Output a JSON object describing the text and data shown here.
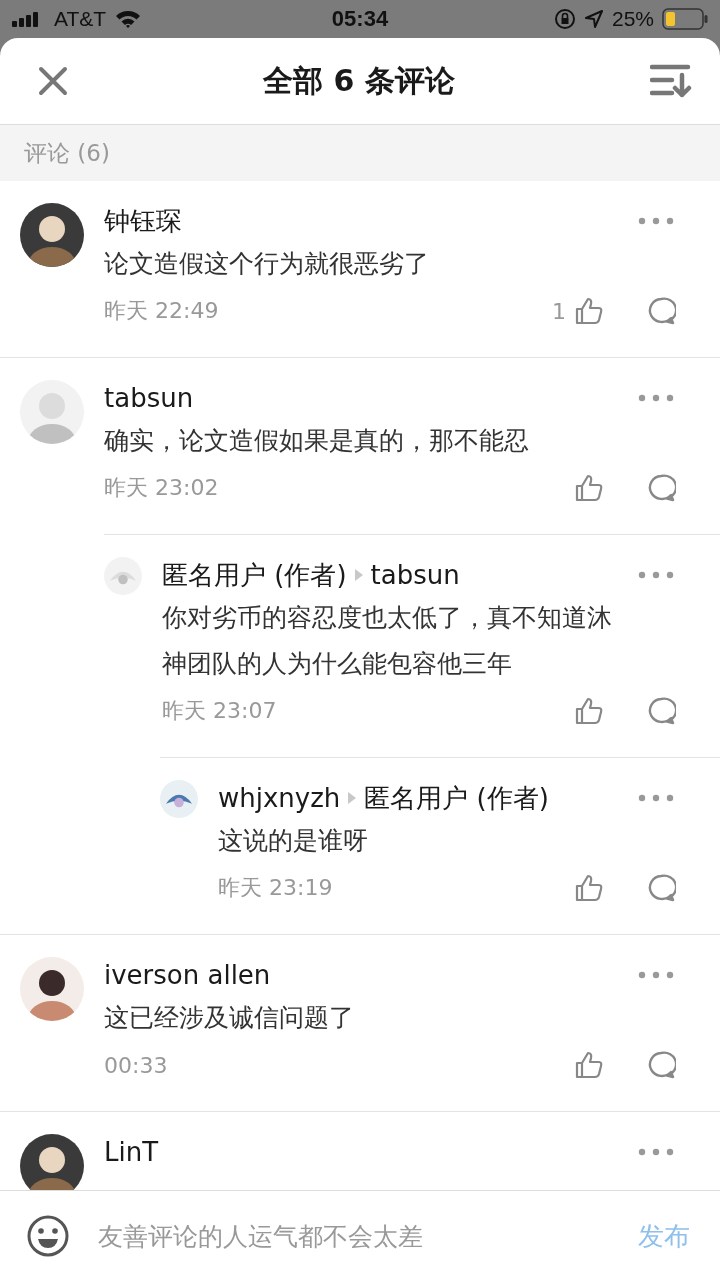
{
  "status_bar": {
    "carrier": "AT&T",
    "time": "05:34",
    "battery": "25%"
  },
  "header": {
    "title": "全部 6 条评论"
  },
  "section": {
    "label": "评论 (6)"
  },
  "comments": [
    {
      "author": "钟钰琛",
      "text": "论文造假这个行为就很恶劣了",
      "time": "昨天 22:49",
      "likes": "1"
    },
    {
      "author": "tabsun",
      "text": "确实，论文造假如果是真的，那不能忍",
      "time": "昨天 23:02",
      "replies": [
        {
          "author": "匿名用户 (作者)",
          "reply_to": "tabsun",
          "text": "你对劣币的容忍度也太低了，真不知道沐神团队的人为什么能包容他三年",
          "time": "昨天 23:07"
        },
        {
          "author": "whjxnyzh",
          "reply_to": "匿名用户 (作者)",
          "text": "这说的是谁呀",
          "time": "昨天 23:19"
        }
      ]
    },
    {
      "author": "iverson allen",
      "text": "这已经涉及诚信问题了",
      "time": "00:33"
    },
    {
      "author": "LinT"
    }
  ],
  "composer": {
    "placeholder": "友善评论的人运气都不会太差",
    "submit": "发布"
  }
}
